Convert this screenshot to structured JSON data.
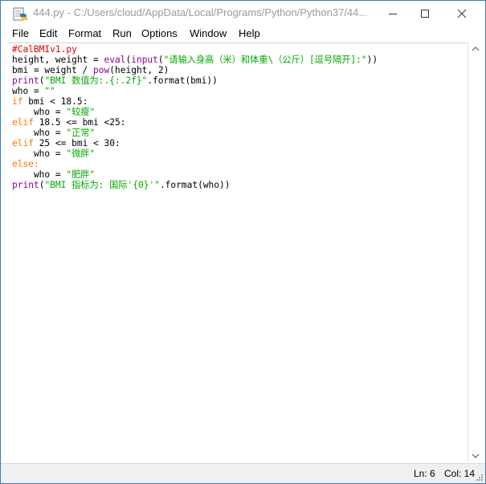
{
  "window": {
    "title": "444.py - C:/Users/cloud/AppData/Local/Programs/Python/Python37/44...",
    "icon": "python-idle-icon"
  },
  "controls": [
    "minimize-icon",
    "maximize-icon",
    "close-icon"
  ],
  "menu": {
    "items": [
      "File",
      "Edit",
      "Format",
      "Run",
      "Options",
      "Window",
      "Help"
    ]
  },
  "editor": {
    "code": {
      "l1": "#CalBMIv1.py",
      "l2a": "height, weight = ",
      "l2b": "eval",
      "l2c": "(",
      "l2d": "input",
      "l2e": "(",
      "l2f": "\"请输入身高（米）和体重\\（公斤）[逗号隔开]:\"",
      "l2g": "))",
      "l3a": "bmi = weight / ",
      "l3b": "pow",
      "l3c": "(height, 2)",
      "l4a": "print",
      "l4b": "(",
      "l4c": "\"BMI 数值为:.{:.2f}\"",
      "l4d": ".format(bmi))",
      "l5a": "who = ",
      "l5b": "\"\"",
      "l6a": "if",
      "l6b": " bmi < 18.5:",
      "l7a": "    who = ",
      "l7b": "\"较瘦\"",
      "l8a": "elif",
      "l8b": " 18.5 <= bmi <25:",
      "l9a": "    who = ",
      "l9b": "\"正常\"",
      "l10a": "elif",
      "l10b": " 25 <= bmi < 30:",
      "l11a": "    who = ",
      "l11b": "\"微胖\"",
      "l12a": "else",
      "l12b": ":",
      "l13a": "    who = ",
      "l13b": "\"肥胖\"",
      "l14a": "print",
      "l14b": "(",
      "l14c": "\"BMI 指标为: 国际'{0}'\"",
      "l14d": ".format(who))"
    },
    "colors": {
      "comment": "#dd0000",
      "keyword": "#ff7700",
      "builtin": "#900090",
      "string": "#00aa00"
    }
  },
  "status": {
    "line": "Ln: 6",
    "col": "Col: 14"
  }
}
